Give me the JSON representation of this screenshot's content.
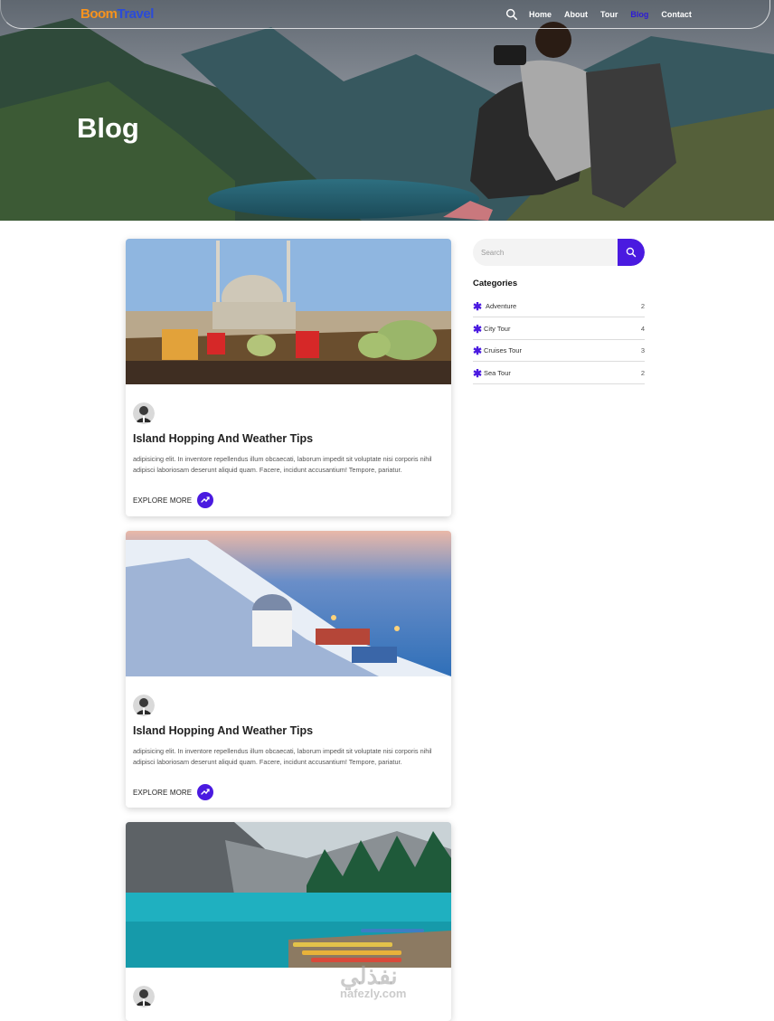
{
  "brand": {
    "part1": "Boom",
    "part2": "Travel"
  },
  "nav": {
    "items": [
      {
        "label": "Home",
        "active": false
      },
      {
        "label": "About",
        "active": false
      },
      {
        "label": "Tour",
        "active": false
      },
      {
        "label": "Blog",
        "active": true
      },
      {
        "label": "Contact",
        "active": false
      }
    ]
  },
  "hero": {
    "title": "Blog"
  },
  "posts": [
    {
      "title": "Island Hopping And Weather Tips",
      "excerpt": "adipisicing elit. In inventore repellendus illum obcaecati, laborum impedit sit voluptate nisi corporis nihil adipisci laboriosam deserunt aliquid quam. Facere, incidunt accusantium! Tempore, pariatur.",
      "cta": "EXPLORE MORE",
      "image": "istanbul-harbor"
    },
    {
      "title": "Island Hopping And Weather Tips",
      "excerpt": "adipisicing elit. In inventore repellendus illum obcaecati, laborum impedit sit voluptate nisi corporis nihil adipisci laboriosam deserunt aliquid quam. Facere, incidunt accusantium! Tempore, pariatur.",
      "cta": "EXPLORE MORE",
      "image": "santorini-terrace"
    },
    {
      "title": "",
      "excerpt": "",
      "cta": "",
      "image": "mountain-lake"
    }
  ],
  "sidebar": {
    "search_placeholder": "Search",
    "categories_title": "Categories",
    "categories": [
      {
        "name": "Adventure",
        "count": "2"
      },
      {
        "name": "City Tour",
        "count": "4"
      },
      {
        "name": "Cruises Tour",
        "count": "3"
      },
      {
        "name": "Sea Tour",
        "count": "2"
      }
    ]
  },
  "watermark": {
    "arabic": "نفذلي",
    "latin": "nafezly.com"
  },
  "colors": {
    "accent": "#4a1ae0",
    "brand_orange": "#f7931e",
    "brand_blue": "#2b4bd8"
  }
}
